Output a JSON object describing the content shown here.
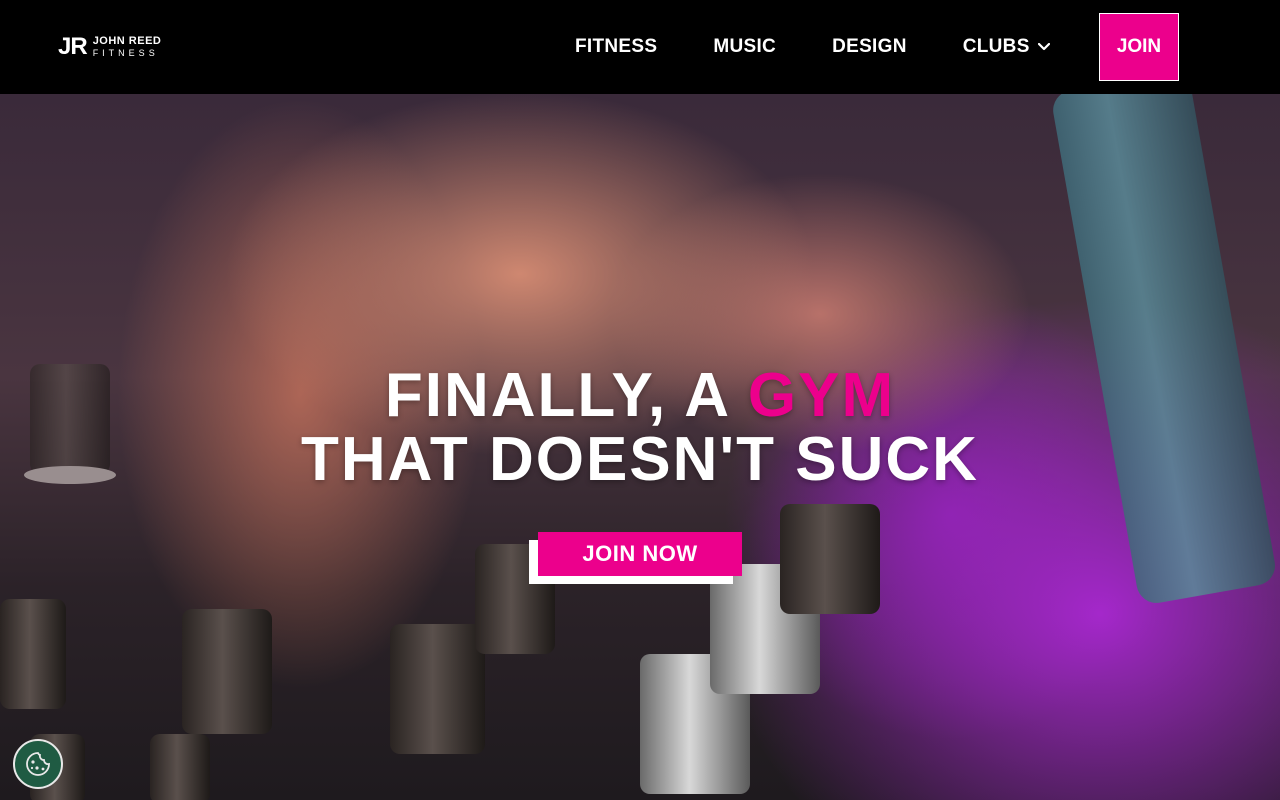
{
  "brand": {
    "mark": "JR",
    "line1": "JOHN REED",
    "line2": "FITNESS"
  },
  "nav": {
    "items": [
      {
        "label": "FITNESS"
      },
      {
        "label": "MUSIC"
      },
      {
        "label": "DESIGN"
      },
      {
        "label": "CLUBS"
      }
    ],
    "join_label": "JOIN"
  },
  "hero": {
    "headline_part1": "FINALLY, A ",
    "headline_accent": "GYM",
    "headline_line2": "THAT DOESN'T SUCK",
    "cta_label": "JOIN NOW"
  },
  "colors": {
    "accent": "#ec008c",
    "navbar": "#000000",
    "cookie_button": "#1f5b43"
  },
  "icons": {
    "clubs_dropdown": "chevron-down-icon",
    "cookie_settings": "cookie-icon"
  }
}
